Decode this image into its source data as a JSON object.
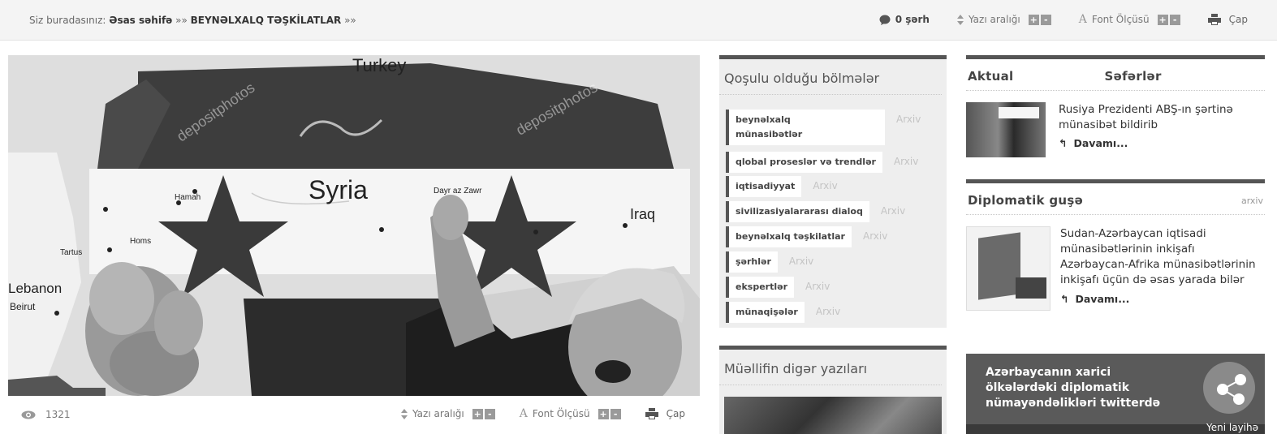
{
  "breadcrumb": {
    "prefix": "Siz buradasınız:",
    "home": "Əsas səhifə",
    "separator": "»»",
    "current": "BEYNƏLXALQ TƏŞKİLATLAR",
    "separator2": "»»"
  },
  "top_tools": {
    "comments": "0 şərh",
    "line_spacing": "Yazı aralığı",
    "font_size": "Font Ölçüsü",
    "print": "Çap",
    "plus": "+",
    "minus": "-"
  },
  "hero": {
    "map_labels": {
      "turkey": "Turkey",
      "syria": "Syria",
      "iraq": "Iraq",
      "lebanon": "Lebanon",
      "beirut": "Beirut",
      "tartus": "Tartus",
      "homs": "Homs",
      "hamah": "Hamah",
      "dayr": "Dayr az Zawr",
      "watermark1": "depositphotos",
      "watermark2": "depositphotos"
    },
    "views": "1321",
    "line_spacing": "Yazı aralığı",
    "font_size": "Font Ölçüsü",
    "print": "Çap"
  },
  "categories": {
    "title": "Qoşulu olduğu bölmələr",
    "archive_label": "Arxiv",
    "items": [
      {
        "line1": "beynəlxalq",
        "line2": "münasibətlər"
      },
      {
        "line1": "qlobal proseslər və trendlər",
        "line2": ""
      },
      {
        "line1": "iqtisadiyyat",
        "line2": ""
      },
      {
        "line1": "sivilizasiyalararası dialoq",
        "line2": ""
      },
      {
        "line1": "beynəlxalq təşkilatlar",
        "line2": ""
      },
      {
        "line1": "şərhlər",
        "line2": ""
      },
      {
        "line1": "ekspertlər",
        "line2": ""
      },
      {
        "line1": "münaqişələr",
        "line2": ""
      }
    ]
  },
  "author": {
    "title": "Müəllifin digər yazıları"
  },
  "aktual": {
    "tab1": "Aktual",
    "tab2": "Səfərlər",
    "news": "Rusiya Prezidenti ABŞ-ın şərtinə münasibət bildirib",
    "more": "Davamı..."
  },
  "diplomatik": {
    "title": "Diplomatik guşə",
    "archive": "arxiv",
    "news": "Sudan-Azərbaycan iqtisadi münasibətlərinin inkişafı Azərbaycan-Afrika münasibətlərinin inkişafı üçün də əsas yarada bilər",
    "more": "Davamı..."
  },
  "banner": {
    "text": "Azərbaycanın xarici ölkələrdəki diplomatik nümayəndəlikləri twitterdə",
    "bottom": "Yeni layihə"
  }
}
